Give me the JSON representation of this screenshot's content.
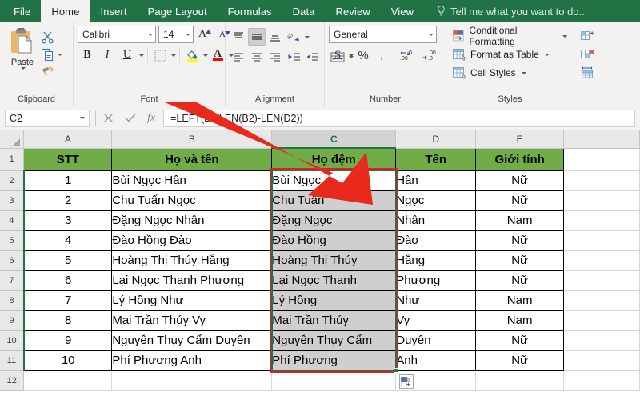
{
  "ribbon_tabs": [
    {
      "label": "File",
      "active": false
    },
    {
      "label": "Home",
      "active": true
    },
    {
      "label": "Insert",
      "active": false
    },
    {
      "label": "Page Layout",
      "active": false
    },
    {
      "label": "Formulas",
      "active": false
    },
    {
      "label": "Data",
      "active": false
    },
    {
      "label": "Review",
      "active": false
    },
    {
      "label": "View",
      "active": false
    }
  ],
  "tell_me": {
    "placeholder": "Tell me what you want to do...",
    "icon": "lightbulb-icon"
  },
  "groups": {
    "clipboard": {
      "label": "Clipboard",
      "paste_label": "Paste",
      "items": [
        "cut-icon",
        "copy-icon",
        "format-painter-icon"
      ]
    },
    "font": {
      "label": "Font",
      "font_name": "Calibri",
      "font_size": "14",
      "bold": "B",
      "italic": "I",
      "underline": "U",
      "grow_font": "A",
      "shrink_font": "A",
      "borders_icon": "borders-icon",
      "fill_color_icon": "fill-color-icon",
      "font_color_icon": "font-color-icon",
      "fill_color": "#ffff00",
      "font_color": "#ff0000"
    },
    "alignment": {
      "label": "Alignment",
      "buttons": [
        "align-top-icon",
        "align-middle-icon",
        "align-bottom-icon",
        "orientation-icon",
        "wrap-text-icon",
        "align-left-icon",
        "align-center-icon",
        "align-right-icon",
        "decrease-indent-icon",
        "increase-indent-icon",
        "merge-center-icon"
      ]
    },
    "number": {
      "label": "Number",
      "format": "General",
      "accounting": "$",
      "percent": "%",
      "comma": ",",
      "increase_decimal": ".00",
      "decrease_decimal": ".00"
    },
    "styles": {
      "label": "Styles",
      "items": [
        {
          "label": "Conditional Formatting",
          "icon": "conditional-formatting-icon"
        },
        {
          "label": "Format as Table",
          "icon": "format-as-table-icon"
        },
        {
          "label": "Cell Styles",
          "icon": "cell-styles-icon"
        }
      ]
    },
    "cells": {
      "label": "Cells",
      "items": [
        {
          "icon": "insert-cells-icon"
        },
        {
          "icon": "delete-cells-icon"
        },
        {
          "icon": "format-cells-icon"
        }
      ]
    }
  },
  "formula_bar": {
    "name_box": "C2",
    "cancel_icon": "cancel-x-icon",
    "confirm_icon": "confirm-check-icon",
    "function_icon": "insert-function-fx-icon",
    "formula": "=LEFT(B2,LEN(B2)-LEN(D2))"
  },
  "sheet": {
    "column_letters": [
      "A",
      "B",
      "C",
      "D",
      "E"
    ],
    "selected_column": "C",
    "row_numbers": [
      "1",
      "2",
      "3",
      "4",
      "5",
      "6",
      "7",
      "8",
      "9",
      "10",
      "11",
      "12"
    ],
    "headers": [
      "STT",
      "Họ và tên",
      "Họ đệm",
      "Tên",
      "Giới tính"
    ],
    "header_fill": "#70ad47",
    "rows": [
      {
        "stt": "1",
        "fullname": "Bùi Ngọc Hân",
        "hodem": "Bùi Ngọc",
        "ten": "Hân",
        "gioitinh": "Nữ"
      },
      {
        "stt": "2",
        "fullname": "Chu Tuấn Ngọc",
        "hodem": "Chu Tuấn",
        "ten": "Ngọc",
        "gioitinh": "Nữ"
      },
      {
        "stt": "3",
        "fullname": "Đặng Ngọc Nhân",
        "hodem": "Đặng Ngọc",
        "ten": "Nhân",
        "gioitinh": "Nam"
      },
      {
        "stt": "4",
        "fullname": "Đào Hồng Đào",
        "hodem": "Đào Hồng",
        "ten": "Đào",
        "gioitinh": "Nữ"
      },
      {
        "stt": "5",
        "fullname": "Hoàng Thị Thúy Hằng",
        "hodem": "Hoàng Thị Thúy",
        "ten": "Hằng",
        "gioitinh": "Nữ"
      },
      {
        "stt": "6",
        "fullname": "Lại Ngọc Thanh Phương",
        "hodem": "Lại Ngọc Thanh",
        "ten": "Phương",
        "gioitinh": "Nữ"
      },
      {
        "stt": "7",
        "fullname": "Lý Hồng Như",
        "hodem": "Lý Hồng",
        "ten": "Như",
        "gioitinh": "Nam"
      },
      {
        "stt": "8",
        "fullname": "Mai Trần Thúy Vy",
        "hodem": "Mai Trần Thúy",
        "ten": "Vy",
        "gioitinh": "Nam"
      },
      {
        "stt": "9",
        "fullname": "Nguyễn Thụy Cẩm Duyên",
        "hodem": "Nguyễn Thụy Cẩm",
        "ten": "Duyên",
        "gioitinh": "Nữ"
      },
      {
        "stt": "10",
        "fullname": "Phí Phương Anh",
        "hodem": "Phí Phương",
        "ten": "Anh",
        "gioitinh": "Nữ"
      }
    ],
    "autofill_icon": "autofill-options-icon"
  },
  "annotation": {
    "arrow_color": "#e8291c",
    "name": "red-arrow-annotation"
  }
}
